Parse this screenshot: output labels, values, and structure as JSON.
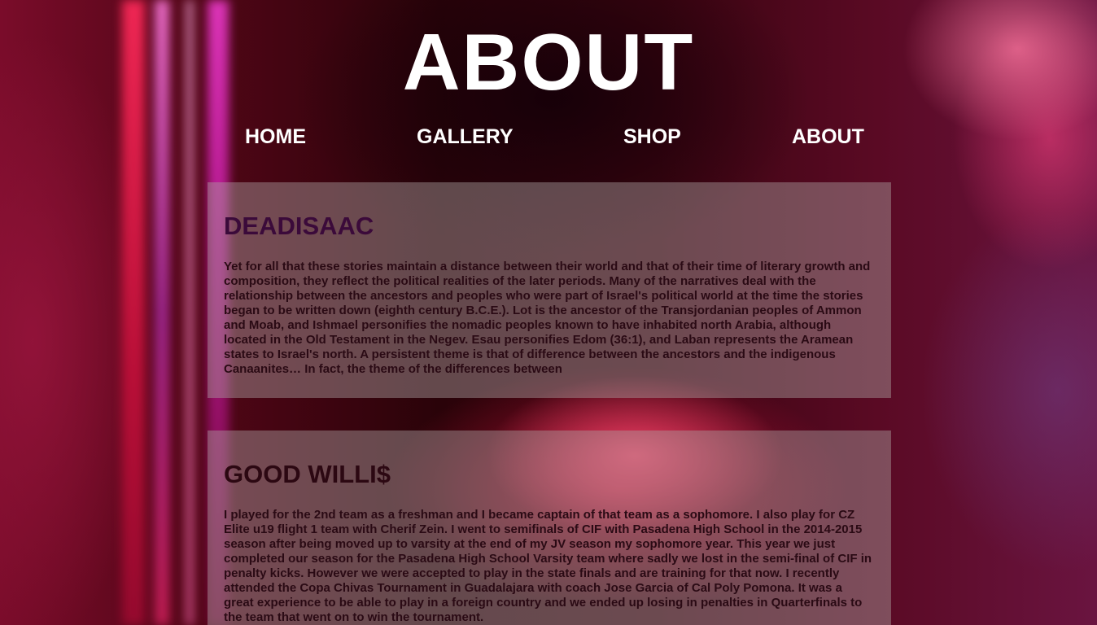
{
  "page": {
    "title": "ABOUT"
  },
  "nav": {
    "items": [
      "HOME",
      "GALLERY",
      "SHOP",
      "ABOUT"
    ]
  },
  "sections": [
    {
      "heading": "DEADISAAC",
      "body": "Yet for all that these stories maintain a distance between their world and that of their time of literary growth and composition, they reflect the political realities of the later periods. Many of the narratives deal with the relationship between the ancestors and peoples who were part of Israel's political world at the time the stories began to be written down (eighth century B.C.E.). Lot is the ancestor of the Transjordanian peoples of Ammon and Moab, and Ishmael personifies the nomadic peoples known to have inhabited north Arabia, although located in the Old Testament in the Negev. Esau personifies Edom (36:1), and Laban represents the Aramean states to Israel's north. A persistent theme is that of difference between the ancestors and the indigenous Canaanites… In fact, the theme of the differences between"
    },
    {
      "heading": "GOOD WILLI$",
      "body": "I played for the 2nd team as a freshman and I became captain of that team as a sophomore. I also play for CZ Elite u19 flight 1 team with Cherif Zein. I went to semifinals of CIF with Pasadena High School in the 2014-2015 season after being moved up to varsity at the end of my JV season my sophomore year. This year we just completed our season for the Pasadena High School Varsity team where sadly we lost in the semi-final of CIF in penalty kicks. However we were accepted to play in the state finals and are training for that now. I recently attended the Copa Chivas Tournament in Guadalajara with coach Jose Garcia of Cal Poly Pomona. It was a great experience to be able to play in a foreign country and we ended up losing in penalties in Quarterfinals to the team that went on to win the tournament."
    }
  ]
}
